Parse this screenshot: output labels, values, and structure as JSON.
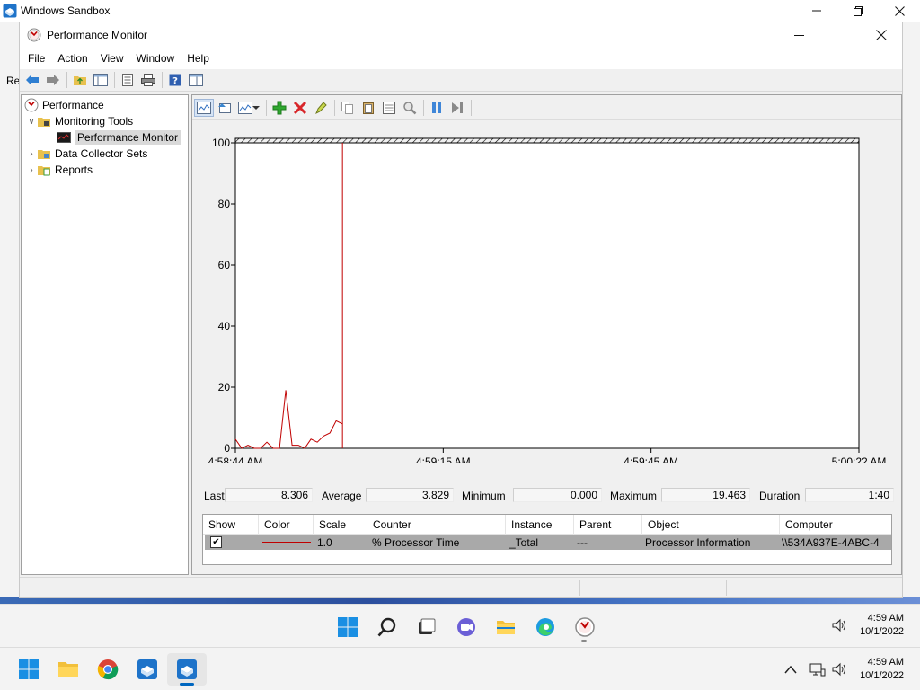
{
  "sandbox": {
    "title": "Windows Sandbox",
    "edge_label": "Re"
  },
  "window": {
    "title": "Performance Monitor"
  },
  "menu": [
    "File",
    "Action",
    "View",
    "Window",
    "Help"
  ],
  "tree": {
    "root": "Performance",
    "monitoring_tools": "Monitoring Tools",
    "performance_monitor": "Performance Monitor",
    "data_collector_sets": "Data Collector Sets",
    "reports": "Reports"
  },
  "chart_data": {
    "type": "line",
    "title": "",
    "xlabel": "",
    "ylabel": "",
    "ylim": [
      0,
      100
    ],
    "y_ticks": [
      "100",
      "80",
      "60",
      "40",
      "20",
      "0"
    ],
    "x_ticks": [
      "4:58:44 AM",
      "4:59:15 AM",
      "4:59:45 AM",
      "5:00:22 AM"
    ],
    "samples_total": 100,
    "current_sample_index": 17,
    "series": [
      {
        "name": "% Processor Time",
        "color": "#c00000",
        "values": [
          3,
          0,
          1,
          0,
          0,
          2,
          0,
          0,
          19,
          1,
          1,
          0,
          3,
          2,
          4,
          5,
          9,
          8
        ]
      }
    ],
    "grid": false
  },
  "stats": {
    "last_label": "Last",
    "last": "8.306",
    "average_label": "Average",
    "average": "3.829",
    "minimum_label": "Minimum",
    "minimum": "0.000",
    "maximum_label": "Maximum",
    "maximum": "19.463",
    "duration_label": "Duration",
    "duration": "1:40"
  },
  "legend": {
    "headers": [
      "Show",
      "Color",
      "Scale",
      "Counter",
      "Instance",
      "Parent",
      "Object",
      "Computer"
    ],
    "row": {
      "show": "✔",
      "color": "#c00000",
      "scale": "1.0",
      "counter": "% Processor Time",
      "instance": "_Total",
      "parent": "---",
      "object": "Processor Information",
      "computer": "\\\\534A937E-4ABC-4"
    }
  },
  "inner_taskbar": {
    "time": "4:59 AM",
    "date": "10/1/2022"
  },
  "host_taskbar": {
    "time": "4:59 AM",
    "date": "10/1/2022"
  },
  "colors": {
    "accent": "#0067c0",
    "line": "#c00000"
  }
}
